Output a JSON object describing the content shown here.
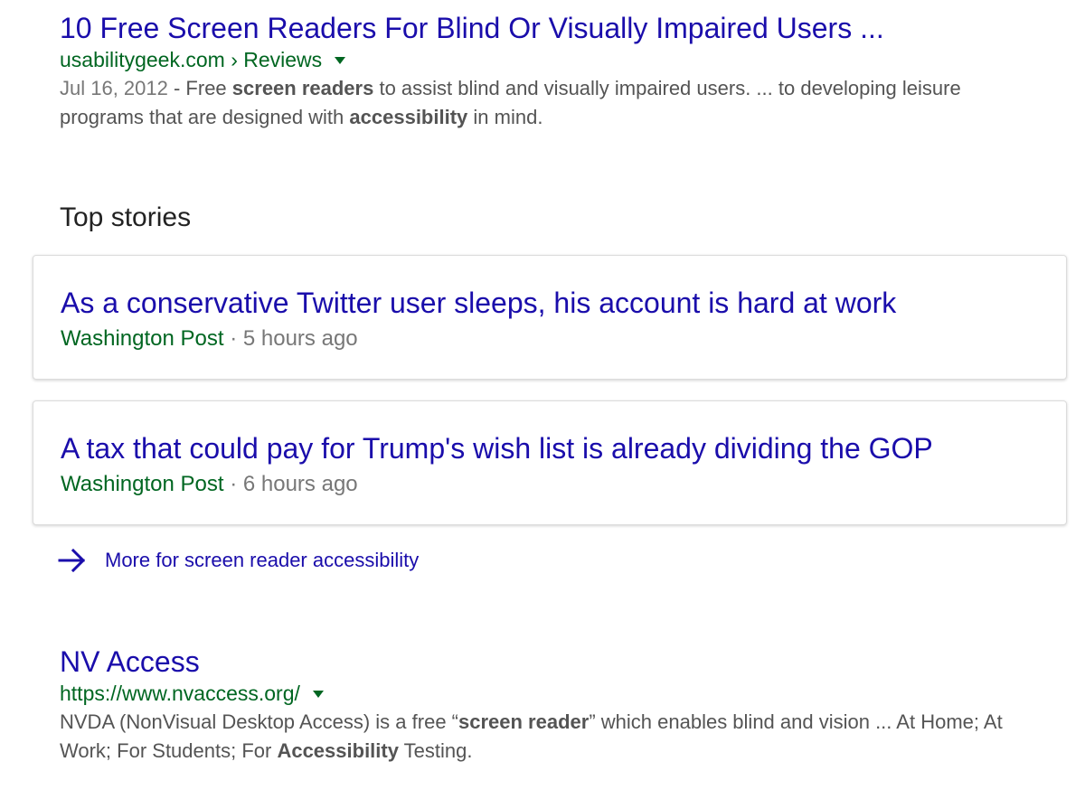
{
  "results": [
    {
      "title": "10 Free Screen Readers For Blind Or Visually Impaired Users ...",
      "cite": "usabilitygeek.com › Reviews",
      "date": "Jul 16, 2012",
      "snippet_parts": [
        {
          "text": " - Free ",
          "bold": false
        },
        {
          "text": "screen readers",
          "bold": true
        },
        {
          "text": " to assist blind and visually impaired users. ... to developing leisure programs that are designed with ",
          "bold": false
        },
        {
          "text": "accessibility",
          "bold": true
        },
        {
          "text": " in mind.",
          "bold": false
        }
      ]
    },
    {
      "title": "NV Access",
      "cite": "https://www.nvaccess.org/",
      "date": "",
      "snippet_parts": [
        {
          "text": "NVDA (NonVisual Desktop Access) is a free “",
          "bold": false
        },
        {
          "text": "screen reader",
          "bold": true
        },
        {
          "text": "” which enables blind and vision ... At Home; At Work; For Students; For ",
          "bold": false
        },
        {
          "text": "Accessibility",
          "bold": true
        },
        {
          "text": " Testing.",
          "bold": false
        }
      ]
    }
  ],
  "top_stories": {
    "heading": "Top stories",
    "separator": " · ",
    "stories": [
      {
        "title": "As a conservative Twitter user sleeps, his account is hard at work",
        "source": "Washington Post",
        "time": "5 hours ago"
      },
      {
        "title": "A tax that could pay for Trump's wish list is already dividing the GOP",
        "source": "Washington Post",
        "time": "6 hours ago"
      }
    ],
    "more_label": "More for screen reader accessibility",
    "more_icon": "arrow-right-icon"
  },
  "colors": {
    "link": "#1a0dab",
    "cite": "#006621",
    "snippet": "#545454",
    "meta": "#777777"
  }
}
